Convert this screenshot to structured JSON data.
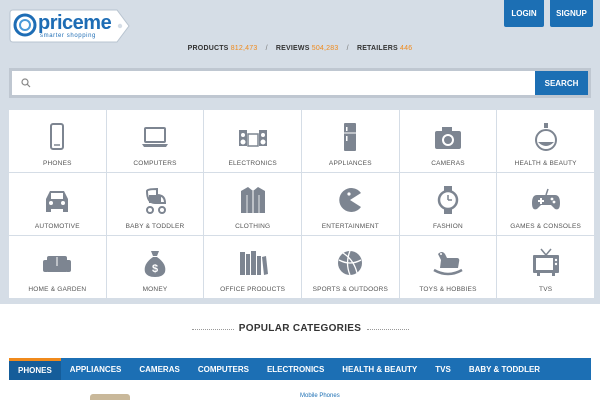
{
  "brand": {
    "name": "priceme",
    "tagline": "smarter shopping",
    "color": "#1e6db5"
  },
  "auth": {
    "login_label": "LOGIN",
    "signup_label": "SIGNUP"
  },
  "stats": {
    "products_label": "PRODUCTS",
    "products_count": "812,473",
    "reviews_label": "REVIEWS",
    "reviews_count": "504,283",
    "retailers_label": "RETAILERS",
    "retailers_count": "446",
    "separator": "/"
  },
  "search": {
    "placeholder": "",
    "button_label": "SEARCH"
  },
  "categories": [
    {
      "label": "PHONES",
      "icon": "phone-icon"
    },
    {
      "label": "COMPUTERS",
      "icon": "laptop-icon"
    },
    {
      "label": "ELECTRONICS",
      "icon": "stereo-icon"
    },
    {
      "label": "APPLIANCES",
      "icon": "fridge-icon"
    },
    {
      "label": "CAMERAS",
      "icon": "camera-icon"
    },
    {
      "label": "HEALTH & BEAUTY",
      "icon": "perfume-icon"
    },
    {
      "label": "AUTOMOTIVE",
      "icon": "car-icon"
    },
    {
      "label": "BABY & TODDLER",
      "icon": "stroller-icon"
    },
    {
      "label": "CLOTHING",
      "icon": "jacket-icon"
    },
    {
      "label": "ENTERTAINMENT",
      "icon": "pacman-icon"
    },
    {
      "label": "FASHION",
      "icon": "watch-icon"
    },
    {
      "label": "GAMES & CONSOLES",
      "icon": "gamepad-icon"
    },
    {
      "label": "HOME & GARDEN",
      "icon": "sofa-icon"
    },
    {
      "label": "MONEY",
      "icon": "money-bag-icon"
    },
    {
      "label": "OFFICE PRODUCTS",
      "icon": "books-icon"
    },
    {
      "label": "SPORTS & OUTDOORS",
      "icon": "ball-icon"
    },
    {
      "label": "TOYS & HOBBIES",
      "icon": "rocking-horse-icon"
    },
    {
      "label": "TVS",
      "icon": "tv-icon"
    }
  ],
  "popular": {
    "title": "POPULAR CATEGORIES",
    "tabs": [
      "PHONES",
      "APPLIANCES",
      "CAMERAS",
      "COMPUTERS",
      "ELECTRONICS",
      "HEALTH & BEAUTY",
      "TVS",
      "BABY & TODDLER"
    ],
    "active_tab": "PHONES",
    "sub_link": "Mobile Phones"
  },
  "colors": {
    "primary": "#1c6fb4",
    "accent": "#f08a1c",
    "icon": "#7d8591",
    "background": "#d5dde6"
  }
}
